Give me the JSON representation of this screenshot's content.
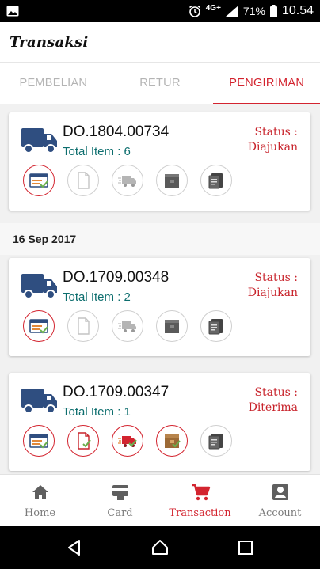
{
  "status_bar": {
    "network": "4G+",
    "battery": "71%",
    "time": "10.54"
  },
  "header": {
    "title": "Transaksi"
  },
  "tabs": [
    {
      "label": "PEMBELIAN",
      "active": false
    },
    {
      "label": "RETUR",
      "active": false
    },
    {
      "label": "PENGIRIMAN",
      "active": true
    }
  ],
  "colors": {
    "accent": "#d3242f",
    "truck": "#2f4e80",
    "items_text": "#0d6e6e"
  },
  "shipments": [
    {
      "do_number": "DO.1804.00734",
      "total_items": "Total Item : 6",
      "status_label": "Status :",
      "status": "Diajukan",
      "steps_done": [
        true,
        false,
        false,
        false,
        false
      ]
    },
    {
      "do_number": "DO.1709.00348",
      "total_items": "Total Item : 2",
      "status_label": "Status :",
      "status": "Diajukan",
      "steps_done": [
        true,
        false,
        false,
        false,
        false
      ]
    },
    {
      "do_number": "DO.1709.00347",
      "total_items": "Total Item : 1",
      "status_label": "Status :",
      "status": "Diterima",
      "steps_done": [
        true,
        true,
        true,
        true,
        false
      ]
    }
  ],
  "step_icons": [
    "invoice-icon",
    "document-icon",
    "delivery-truck-icon",
    "package-icon",
    "clipboard-icon"
  ],
  "date_group": "16 Sep 2017",
  "bottom_nav": [
    {
      "label": "Home",
      "icon": "home-icon",
      "active": false
    },
    {
      "label": "Card",
      "icon": "card-icon",
      "active": false
    },
    {
      "label": "Transaction",
      "icon": "cart-icon",
      "active": true
    },
    {
      "label": "Account",
      "icon": "account-icon",
      "active": false
    }
  ]
}
